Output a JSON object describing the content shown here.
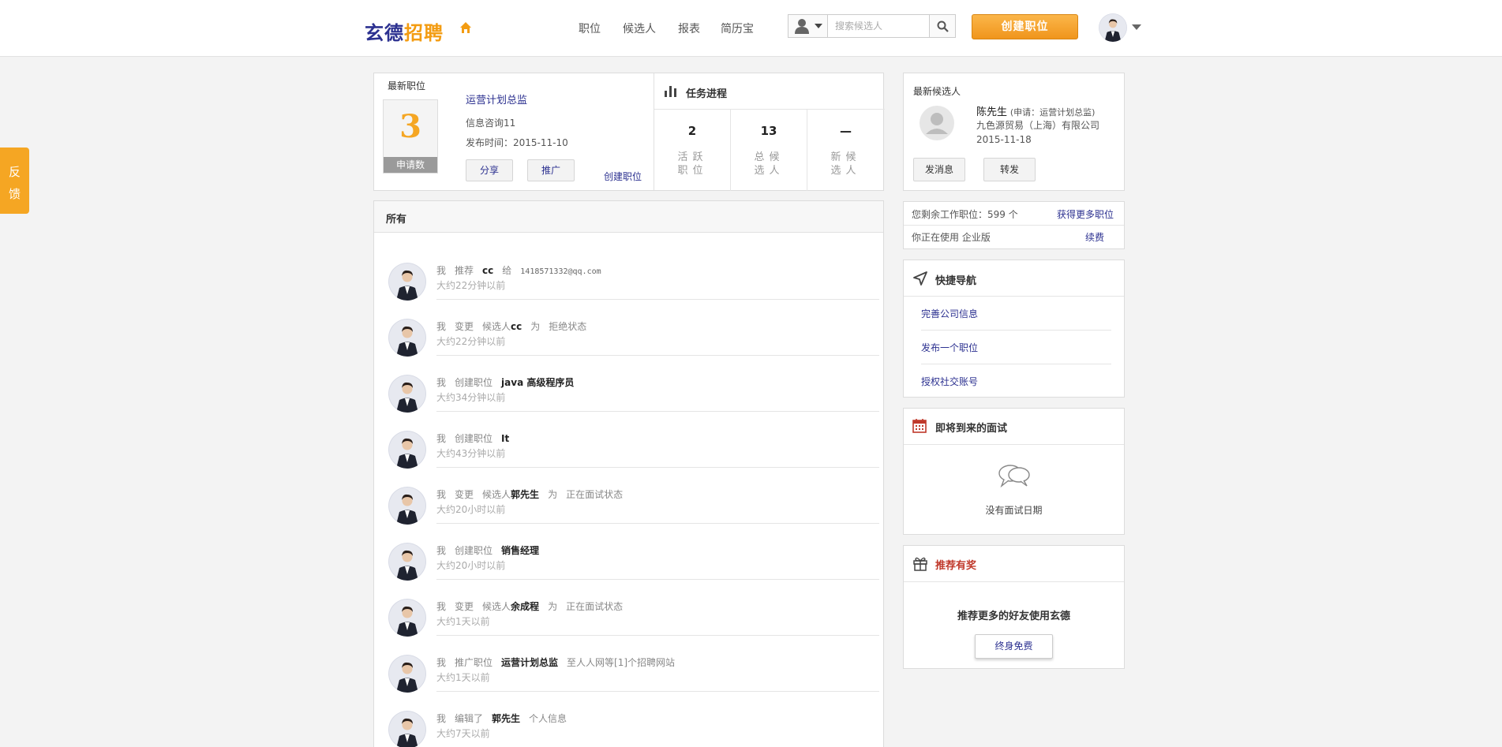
{
  "header": {
    "logo_part1": "玄德",
    "logo_part2": "招聘",
    "nav": [
      "职位",
      "候选人",
      "报表",
      "简历宝"
    ],
    "search_placeholder": "搜索候选人",
    "create_button": "创建职位"
  },
  "feedback": {
    "line1": "反",
    "line2": "馈"
  },
  "latest_job": {
    "title": "最新职位",
    "count": "3",
    "count_label": "申请数",
    "job_name": "运营计划总监",
    "info": "信息咨询11",
    "published": "发布时间：2015-11-10",
    "share": "分享",
    "promote": "推广",
    "create_link": "创建职位"
  },
  "progress": {
    "title": "任务进程",
    "stats": [
      {
        "num": "2",
        "label": "活跃职位"
      },
      {
        "num": "13",
        "label": "总候选人"
      },
      {
        "num": "—",
        "label": "新候选人"
      }
    ]
  },
  "activity": {
    "title": "所有",
    "items": [
      {
        "parts": [
          [
            "我",
            "n"
          ],
          [
            "推荐",
            "n"
          ],
          [
            "cc",
            "b"
          ],
          [
            "给",
            "n"
          ],
          [
            "1418571332@qq.com",
            "m"
          ]
        ],
        "time": "大约22分钟以前"
      },
      {
        "parts": [
          [
            "我",
            "n"
          ],
          [
            "变更",
            "n"
          ],
          [
            "候选人",
            "n0"
          ],
          [
            "cc",
            "b"
          ],
          [
            "为",
            "n"
          ],
          [
            "拒绝状态",
            "n"
          ]
        ],
        "time": "大约22分钟以前"
      },
      {
        "parts": [
          [
            "我",
            "n"
          ],
          [
            "创建职位",
            "n"
          ],
          [
            "java 高级程序员",
            "b"
          ]
        ],
        "time": "大约34分钟以前"
      },
      {
        "parts": [
          [
            "我",
            "n"
          ],
          [
            "创建职位",
            "n"
          ],
          [
            "It",
            "b"
          ]
        ],
        "time": "大约43分钟以前"
      },
      {
        "parts": [
          [
            "我",
            "n"
          ],
          [
            "变更",
            "n"
          ],
          [
            "候选人",
            "n0"
          ],
          [
            "郭先生",
            "b"
          ],
          [
            "为",
            "n"
          ],
          [
            "正在面试状态",
            "n"
          ]
        ],
        "time": "大约20小时以前"
      },
      {
        "parts": [
          [
            "我",
            "n"
          ],
          [
            "创建职位",
            "n"
          ],
          [
            "销售经理",
            "b"
          ]
        ],
        "time": "大约20小时以前"
      },
      {
        "parts": [
          [
            "我",
            "n"
          ],
          [
            "变更",
            "n"
          ],
          [
            "候选人",
            "n0"
          ],
          [
            "余成程",
            "b"
          ],
          [
            "为",
            "n"
          ],
          [
            "正在面试状态",
            "n"
          ]
        ],
        "time": "大约1天以前"
      },
      {
        "parts": [
          [
            "我",
            "n"
          ],
          [
            "推广职位",
            "n"
          ],
          [
            "运营计划总监",
            "b"
          ],
          [
            "至人人网等[1]个招聘网站",
            "n"
          ]
        ],
        "time": "大约1天以前"
      },
      {
        "parts": [
          [
            "我",
            "n"
          ],
          [
            "编辑了",
            "n"
          ],
          [
            "郭先生",
            "b"
          ],
          [
            "个人信息",
            "n"
          ]
        ],
        "time": "大约7天以前"
      }
    ]
  },
  "latest_candidate": {
    "title": "最新候选人",
    "name": "陈先生",
    "applied": "(申请：运营计划总监)",
    "company": "九色源贸易（上海）有限公司",
    "date": "2015-11-18",
    "message_btn": "发消息",
    "forward_btn": "转发"
  },
  "quota": {
    "remaining": "您剩余工作职位：599 个",
    "get_more": "获得更多职位",
    "using": "你正在使用 企业版",
    "renew": "续费"
  },
  "quick_nav": {
    "title": "快捷导航",
    "items": [
      "完善公司信息",
      "发布一个职位",
      "授权社交账号"
    ]
  },
  "interviews": {
    "title": "即将到来的面试",
    "empty": "没有面试日期"
  },
  "referral": {
    "title": "推荐有奖",
    "text": "推荐更多的好友使用玄德",
    "button": "终身免费"
  },
  "colors": {
    "brand_blue": "#2c3190",
    "brand_orange": "#f39c12",
    "referral_red": "#c0392b"
  }
}
